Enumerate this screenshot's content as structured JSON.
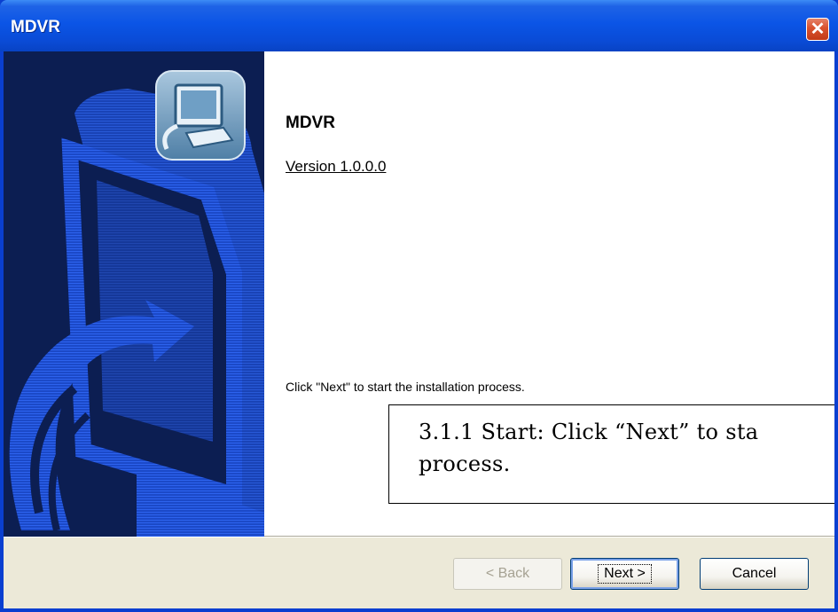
{
  "window": {
    "title": "MDVR",
    "close_glyph": "✕"
  },
  "content": {
    "product_name": "MDVR",
    "version": "Version 1.0.0.0",
    "instruction": "Click \"Next\" to start the installation process."
  },
  "annotation": {
    "line1": "3.1.1 Start: Click “Next” to sta",
    "line2": "process."
  },
  "buttons": {
    "back": {
      "label": "< Back",
      "enabled": false,
      "accesskey": "B"
    },
    "next": {
      "label": "Next >",
      "enabled": true,
      "accesskey": "N",
      "default": true
    },
    "cancel": {
      "label": "Cancel",
      "enabled": true
    }
  },
  "colors": {
    "titlebar": "#0a4bd6",
    "banner_background": "#0c1e52",
    "banner_graphic": "#2456d8",
    "footer": "#ece9d8",
    "close_button": "#d9512d"
  },
  "icons": [
    "close-icon",
    "installer-computer-icon"
  ]
}
